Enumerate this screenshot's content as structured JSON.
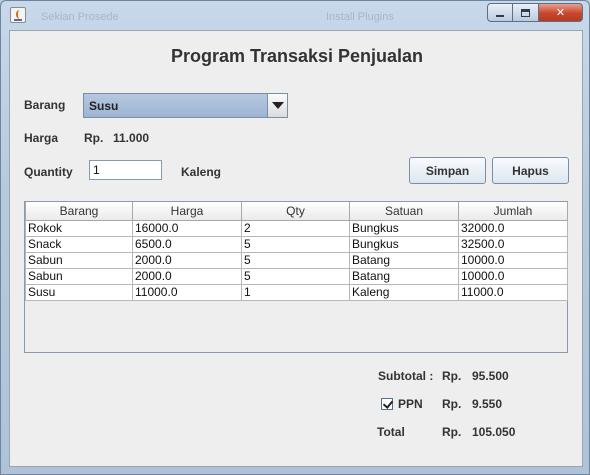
{
  "titlebar": {
    "background_items": [
      "Sekian Prosede",
      "Install Plugins"
    ],
    "minimize": "minimize",
    "maximize": "maximize",
    "close": "close"
  },
  "form": {
    "title": "Program Transaksi Penjualan",
    "barang_label": "Barang",
    "barang_value": "Susu",
    "harga_label": "Harga",
    "harga_currency": "Rp.",
    "harga_value": "11.000",
    "quantity_label": "Quantity",
    "quantity_value": "1",
    "satuan_value": "Kaleng",
    "simpan_label": "Simpan",
    "hapus_label": "Hapus"
  },
  "table": {
    "columns": [
      "Barang",
      "Harga",
      "Qty",
      "Satuan",
      "Jumlah"
    ],
    "rows": [
      [
        "Rokok",
        "16000.0",
        "2",
        "Bungkus",
        "32000.0"
      ],
      [
        "Snack",
        "6500.0",
        "5",
        "Bungkus",
        "32500.0"
      ],
      [
        "Sabun",
        "2000.0",
        "5",
        "Batang",
        "10000.0"
      ],
      [
        "Sabun",
        "2000.0",
        "5",
        "Batang",
        "10000.0"
      ],
      [
        "Susu",
        "11000.0",
        "1",
        "Kaleng",
        "11000.0"
      ]
    ]
  },
  "summary": {
    "subtotal_label": "Subtotal :",
    "subtotal_currency": "Rp.",
    "subtotal_value": "95.500",
    "ppn_label": "PPN",
    "ppn_checked": true,
    "ppn_currency": "Rp.",
    "ppn_value": "9.550",
    "total_label": "Total",
    "total_currency": "Rp.",
    "total_value": "105.050"
  },
  "colors": {
    "combo_selected": "#a9bed9",
    "panel_bg": "#eeeeee",
    "close_button": "#c9462c"
  }
}
